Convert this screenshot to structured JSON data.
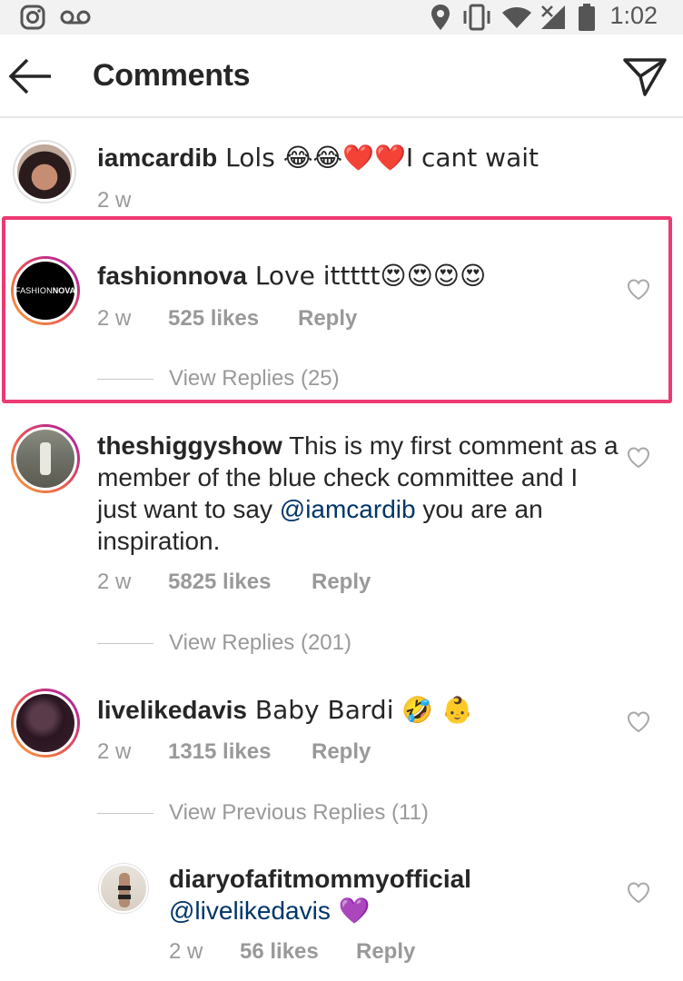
{
  "status_bar": {
    "time": "1:02",
    "left_icons": [
      "instagram-icon",
      "voicemail-icon"
    ],
    "right_icons": [
      "location-icon",
      "vibrate-icon",
      "wifi-icon",
      "signal-icon",
      "battery-icon"
    ]
  },
  "header": {
    "title": "Comments",
    "back_icon": "arrow-left-icon",
    "share_icon": "send-icon"
  },
  "comments": [
    {
      "username": "iamcardib",
      "text": " Lols 😂😂❤️❤️I cant wait",
      "time": "2 w"
    },
    {
      "username": "fashionnova",
      "text": " Love ittttt😍😍😍😍",
      "avatar_label_a": "FASHION",
      "avatar_label_b": "NOVA",
      "time": "2 w",
      "likes": "525 likes",
      "reply": "Reply",
      "view_replies": "View Replies (25)",
      "highlighted": true
    },
    {
      "username": "theshiggyshow",
      "text_before": " This is my first comment as a member of the blue check committee and I just want to say ",
      "mention": "@iamcardib",
      "text_after": " you are an inspiration.",
      "time": "2 w",
      "likes": "5825 likes",
      "reply": "Reply",
      "view_replies": "View Replies (201)"
    },
    {
      "username": "livelikedavis",
      "text": " Baby Bardi 🤣 👶",
      "time": "2 w",
      "likes": "1315 likes",
      "reply": "Reply",
      "view_replies": "View Previous Replies (11)"
    },
    {
      "username": "diaryofafitmommyofficial",
      "mention": "@livelikedavis",
      "text_after": " 💜",
      "time": "2 w",
      "likes": "56 likes",
      "reply": "Reply"
    }
  ],
  "colors": {
    "highlight_border": "#ec3a73",
    "meta_text": "#999999",
    "mention": "#003569",
    "header_border": "#e6e6e6"
  }
}
